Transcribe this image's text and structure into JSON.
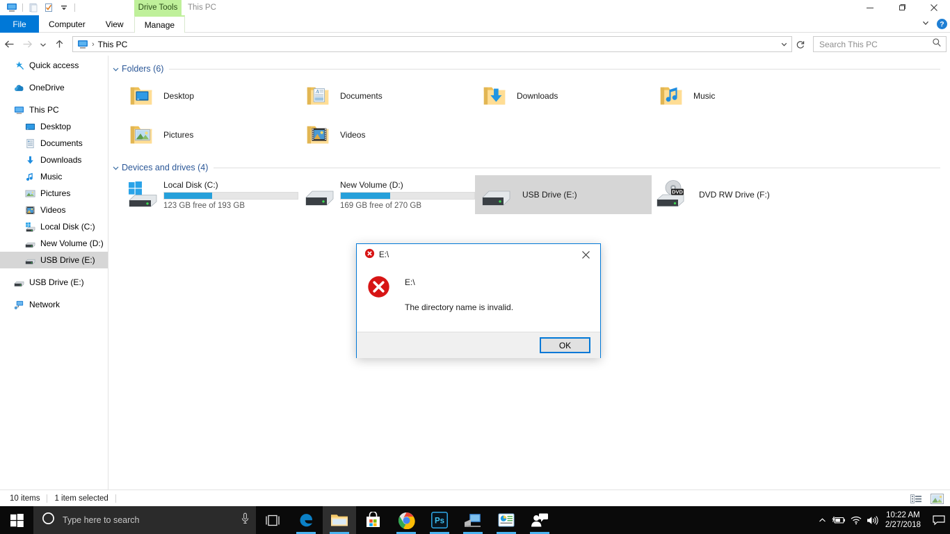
{
  "window": {
    "title": "This PC",
    "contextual_tab_group": "Drive Tools",
    "quick_access_icons": [
      "this-pc-icon",
      "properties-icon",
      "new-folder-icon",
      "customize-dropdown-icon"
    ],
    "controls": {
      "minimize": "minimize-icon",
      "maximize": "maximize-icon",
      "close": "close-icon"
    },
    "ribbon_collapse": "chevron-down-icon",
    "help": "?"
  },
  "ribbon": {
    "tabs": [
      {
        "label": "File",
        "state": "file"
      },
      {
        "label": "Computer",
        "state": "normal"
      },
      {
        "label": "View",
        "state": "normal"
      },
      {
        "label": "Manage",
        "state": "contextual"
      }
    ]
  },
  "nav": {
    "back": "back-arrow-icon",
    "forward": "forward-arrow-icon",
    "recent": "recent-locations-icon",
    "up": "up-arrow-icon",
    "breadcrumb_icon": "this-pc-icon",
    "breadcrumb_separator": "›",
    "breadcrumb": "This PC",
    "address_dropdown": "chevron-down-icon",
    "refresh": "refresh-icon"
  },
  "search": {
    "placeholder": "Search This PC",
    "icon": "search-icon"
  },
  "sidebar": {
    "items": [
      {
        "label": "Quick access",
        "icon": "star-pin-icon",
        "level": 0,
        "selected": false,
        "gap_after": true
      },
      {
        "label": "OneDrive",
        "icon": "onedrive-cloud-icon",
        "level": 0,
        "selected": false,
        "gap_after": true
      },
      {
        "label": "This PC",
        "icon": "this-pc-icon",
        "level": 0,
        "selected": false,
        "gap_after": false
      },
      {
        "label": "Desktop",
        "icon": "desktop-icon",
        "level": 1,
        "selected": false,
        "gap_after": false
      },
      {
        "label": "Documents",
        "icon": "documents-icon",
        "level": 1,
        "selected": false,
        "gap_after": false
      },
      {
        "label": "Downloads",
        "icon": "downloads-icon",
        "level": 1,
        "selected": false,
        "gap_after": false
      },
      {
        "label": "Music",
        "icon": "music-note-icon",
        "level": 1,
        "selected": false,
        "gap_after": false
      },
      {
        "label": "Pictures",
        "icon": "pictures-icon",
        "level": 1,
        "selected": false,
        "gap_after": false
      },
      {
        "label": "Videos",
        "icon": "videos-icon",
        "level": 1,
        "selected": false,
        "gap_after": false
      },
      {
        "label": "Local Disk (C:)",
        "icon": "windows-drive-icon",
        "level": 1,
        "selected": false,
        "gap_after": false
      },
      {
        "label": "New Volume (D:)",
        "icon": "drive-icon",
        "level": 1,
        "selected": false,
        "gap_after": false
      },
      {
        "label": "USB Drive (E:)",
        "icon": "drive-icon",
        "level": 1,
        "selected": true,
        "gap_after": true
      },
      {
        "label": "USB Drive (E:)",
        "icon": "drive-icon",
        "level": 0,
        "selected": false,
        "gap_after": true
      },
      {
        "label": "Network",
        "icon": "network-icon",
        "level": 0,
        "selected": false,
        "gap_after": false
      }
    ]
  },
  "content": {
    "groups": [
      {
        "title": "Folders (6)",
        "chevron": "chevron-collapse-icon",
        "kind": "folders",
        "items": [
          {
            "label": "Desktop",
            "icon": "folder-desktop-icon"
          },
          {
            "label": "Documents",
            "icon": "folder-documents-icon"
          },
          {
            "label": "Downloads",
            "icon": "folder-downloads-icon"
          },
          {
            "label": "Music",
            "icon": "folder-music-icon"
          },
          {
            "label": "Pictures",
            "icon": "folder-pictures-icon"
          },
          {
            "label": "Videos",
            "icon": "folder-videos-icon"
          }
        ]
      },
      {
        "title": "Devices and drives (4)",
        "chevron": "chevron-collapse-icon",
        "kind": "drives",
        "items": [
          {
            "label": "Local Disk (C:)",
            "icon": "windows-drive-icon",
            "has_gauge": true,
            "free_text": "123 GB free of 193 GB",
            "used_percent": 36,
            "selected": false
          },
          {
            "label": "New Volume (D:)",
            "icon": "drive-icon",
            "has_gauge": true,
            "free_text": "169 GB free of 270 GB",
            "used_percent": 37,
            "selected": false
          },
          {
            "label": "USB Drive (E:)",
            "icon": "drive-icon",
            "has_gauge": false,
            "free_text": "",
            "used_percent": 0,
            "selected": true
          },
          {
            "label": "DVD RW Drive (F:)",
            "icon": "dvd-drive-icon",
            "has_gauge": false,
            "free_text": "",
            "used_percent": 0,
            "selected": false
          }
        ]
      }
    ]
  },
  "statusbar": {
    "item_count": "10 items",
    "selection": "1 item selected",
    "view_details": "details-view-icon",
    "view_large": "large-icons-view-icon"
  },
  "dialog": {
    "title": "E:\\",
    "title_icon": "error-icon",
    "close": "close-icon",
    "heading": "E:\\",
    "message": "The directory name is invalid.",
    "ok_label": "OK",
    "body_icon": "error-icon"
  },
  "taskbar": {
    "start": "windows-start-icon",
    "search_icon": "cortana-circle-icon",
    "search_placeholder": "Type here to search",
    "mic_icon": "microphone-icon",
    "task_view": "task-view-icon",
    "apps": [
      {
        "name": "edge-icon",
        "state": "open"
      },
      {
        "name": "file-explorer-icon",
        "state": "active"
      },
      {
        "name": "microsoft-store-icon",
        "state": "idle"
      },
      {
        "name": "chrome-icon",
        "state": "open"
      },
      {
        "name": "photoshop-icon",
        "state": "open"
      },
      {
        "name": "remote-desktop-icon",
        "state": "open"
      },
      {
        "name": "powerpoint-icon",
        "state": "open"
      },
      {
        "name": "teams-people-icon",
        "state": "open"
      }
    ],
    "tray": {
      "show_hidden": "chevron-up-icon",
      "battery": "battery-charging-icon",
      "wifi": "wifi-icon",
      "volume": "speaker-icon",
      "time": "10:22 AM",
      "date": "2/27/2018",
      "action_center": "action-center-icon"
    }
  },
  "colors": {
    "accent": "#0078d7",
    "gauge": "#26a0da",
    "contextual_tab": "#bff09a",
    "selection": "#d6d6d6",
    "error_red": "#d71515",
    "group_title": "#2b5797"
  }
}
